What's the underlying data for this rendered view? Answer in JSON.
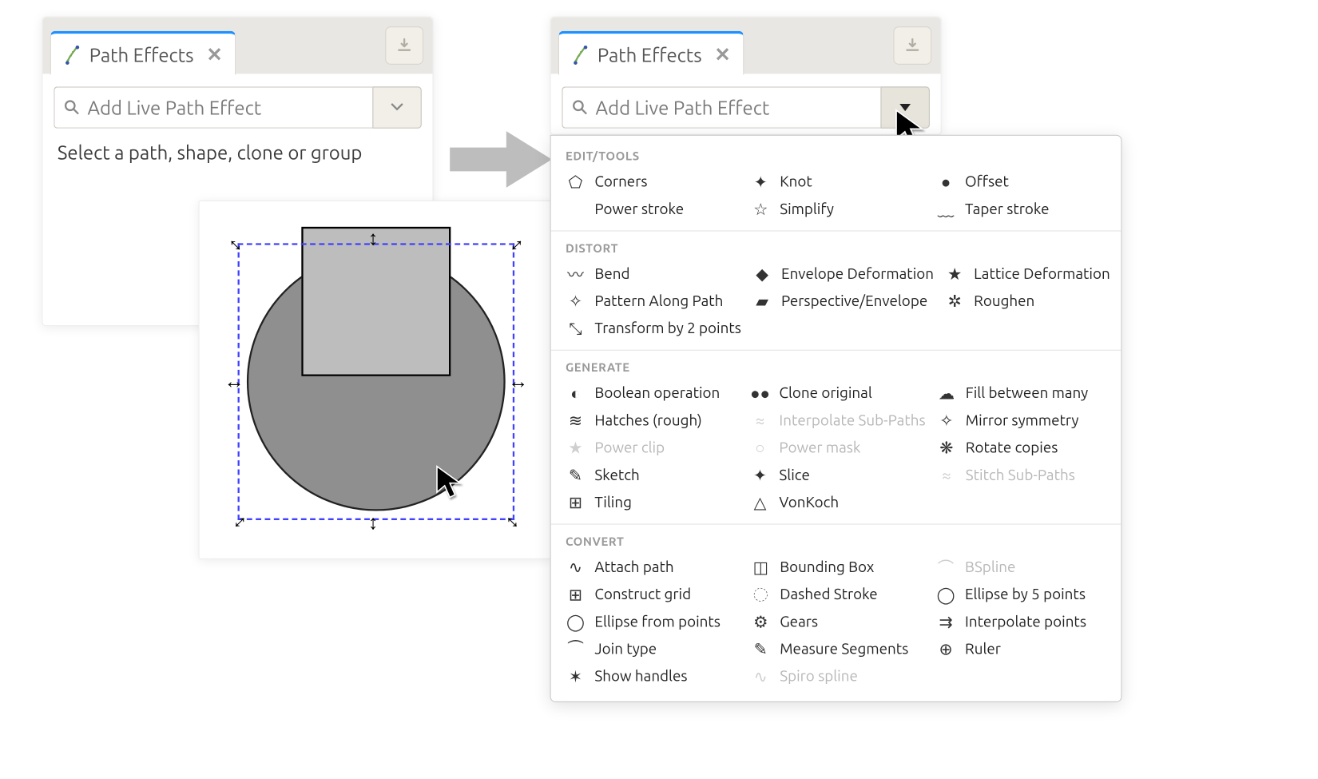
{
  "left_panel": {
    "tab_title": "Path Effects",
    "search_placeholder": "Add Live Path Effect",
    "hint": "Select a path, shape, clone or group"
  },
  "right_panel": {
    "tab_title": "Path Effects",
    "search_placeholder": "Add Live Path Effect"
  },
  "dropdown": {
    "sections": [
      {
        "title": "EDIT/TOOLS",
        "items": [
          {
            "label": "Corners",
            "icon": "⬠",
            "disabled": false
          },
          {
            "label": "Knot",
            "icon": "✦",
            "disabled": false
          },
          {
            "label": "Offset",
            "icon": "●",
            "disabled": false
          },
          {
            "label": "Power stroke",
            "icon": " ",
            "disabled": false
          },
          {
            "label": "Simplify",
            "icon": "☆",
            "disabled": false
          },
          {
            "label": "Taper stroke",
            "icon": "﹏",
            "disabled": false
          }
        ]
      },
      {
        "title": "DISTORT",
        "items": [
          {
            "label": "Bend",
            "icon": "〰",
            "disabled": false
          },
          {
            "label": "Envelope Deformation",
            "icon": "◆",
            "disabled": false
          },
          {
            "label": "Lattice Deformation",
            "icon": "★",
            "disabled": false
          },
          {
            "label": "Pattern Along Path",
            "icon": "✧",
            "disabled": false
          },
          {
            "label": "Perspective/Envelope",
            "icon": "▰",
            "disabled": false
          },
          {
            "label": "Roughen",
            "icon": "✲",
            "disabled": false
          },
          {
            "label": "Transform by 2 points",
            "icon": "⤡",
            "disabled": false
          }
        ]
      },
      {
        "title": "GENERATE",
        "items": [
          {
            "label": "Boolean operation",
            "icon": "◐",
            "disabled": false
          },
          {
            "label": "Clone original",
            "icon": "●●",
            "disabled": false
          },
          {
            "label": "Fill between many",
            "icon": "☁",
            "disabled": false
          },
          {
            "label": "Hatches (rough)",
            "icon": "≋",
            "disabled": false
          },
          {
            "label": "Interpolate Sub-Paths",
            "icon": "≈",
            "disabled": true
          },
          {
            "label": "Mirror symmetry",
            "icon": "✧",
            "disabled": false
          },
          {
            "label": "Power clip",
            "icon": "★",
            "disabled": true
          },
          {
            "label": "Power mask",
            "icon": "○",
            "disabled": true
          },
          {
            "label": "Rotate copies",
            "icon": "❋",
            "disabled": false
          },
          {
            "label": "Sketch",
            "icon": "✎",
            "disabled": false
          },
          {
            "label": "Slice",
            "icon": "✦",
            "disabled": false
          },
          {
            "label": "Stitch Sub-Paths",
            "icon": "≈",
            "disabled": true
          },
          {
            "label": "Tiling",
            "icon": "⊞",
            "disabled": false
          },
          {
            "label": "VonKoch",
            "icon": "△",
            "disabled": false
          }
        ]
      },
      {
        "title": "CONVERT",
        "items": [
          {
            "label": "Attach path",
            "icon": "∿",
            "disabled": false
          },
          {
            "label": "Bounding Box",
            "icon": "◫",
            "disabled": false
          },
          {
            "label": "BSpline",
            "icon": "⌒",
            "disabled": true
          },
          {
            "label": "Construct grid",
            "icon": "⊞",
            "disabled": false
          },
          {
            "label": "Dashed Stroke",
            "icon": "◌",
            "disabled": false
          },
          {
            "label": "Ellipse by 5 points",
            "icon": "◯",
            "disabled": false
          },
          {
            "label": "Ellipse from points",
            "icon": "◯",
            "disabled": false
          },
          {
            "label": "Gears",
            "icon": "⚙",
            "disabled": false
          },
          {
            "label": "Interpolate points",
            "icon": "⇉",
            "disabled": false
          },
          {
            "label": "Join type",
            "icon": "⏜",
            "disabled": false
          },
          {
            "label": "Measure Segments",
            "icon": "✎",
            "disabled": false
          },
          {
            "label": "Ruler",
            "icon": "⊕",
            "disabled": false
          },
          {
            "label": "Show handles",
            "icon": "✶",
            "disabled": false
          },
          {
            "label": "Spiro spline",
            "icon": "∿",
            "disabled": true
          }
        ]
      }
    ]
  }
}
